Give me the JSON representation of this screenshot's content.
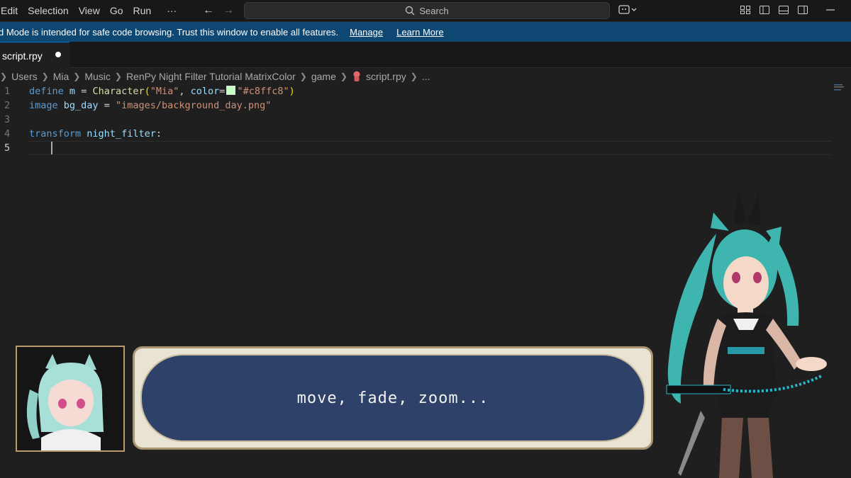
{
  "menu": [
    "Edit",
    "Selection",
    "View",
    "Go",
    "Run",
    "···"
  ],
  "search": {
    "placeholder": "Search"
  },
  "banner": {
    "message": "d Mode is intended for safe code browsing. Trust this window to enable all features.",
    "manage": "Manage",
    "learn_more": "Learn More"
  },
  "tab": {
    "label": "script.rpy"
  },
  "breadcrumb": [
    "Users",
    "Mia",
    "Music",
    "RenPy Night Filter Tutorial MatrixColor",
    "game",
    "script.rpy",
    "..."
  ],
  "editor": {
    "line_numbers": [
      "1",
      "2",
      "3",
      "4",
      "5"
    ],
    "line1": {
      "kw": "define",
      "var": "m",
      "eq": " = ",
      "fn": "Character",
      "open": "(",
      "name": "\"Mia\"",
      "sep": ", ",
      "param": "color",
      "eq2": "=",
      "color_value": "\"#c8ffc8\"",
      "close": ")"
    },
    "line2": {
      "kw": "image",
      "var": "bg_day",
      "eq": " = ",
      "path": "\"images/background_day.png\""
    },
    "line4": {
      "kw": "transform",
      "name": "night_filter",
      "colon": ":"
    }
  },
  "dialogue": {
    "text": "move, fade, zoom..."
  },
  "colors": {
    "banner": "#0e4772",
    "swatch": "#c8ffc8",
    "dialog_bg": "#2e4168"
  },
  "icons": [
    "back-arrow-icon",
    "forward-arrow-icon",
    "search-icon",
    "copilot-icon",
    "layout-icons"
  ]
}
